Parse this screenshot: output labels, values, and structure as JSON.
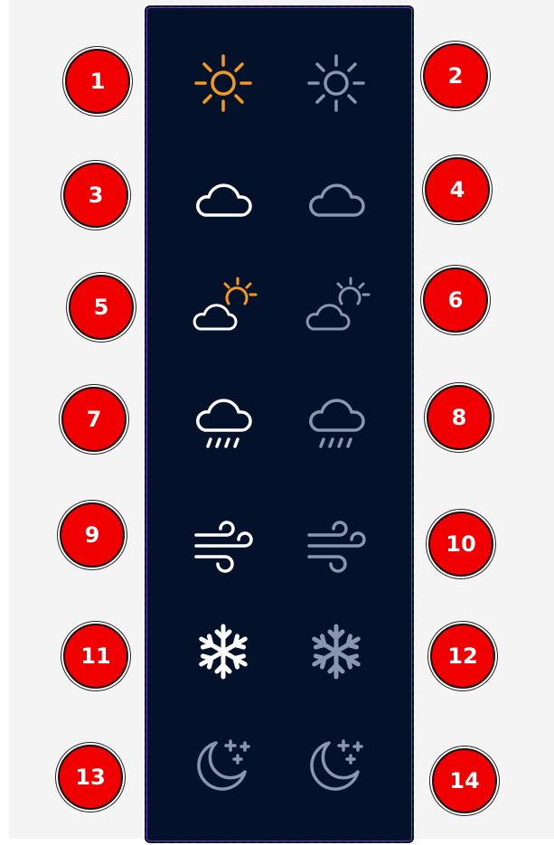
{
  "colors": {
    "panel_bg": "#04112a",
    "accent_orange": "#f39a1c",
    "white": "#ffffff",
    "gray": "#8a96ae",
    "badge_red": "#f00000"
  },
  "icons": [
    {
      "name": "sun-orange-icon",
      "color": "orange"
    },
    {
      "name": "sun-gray-icon",
      "color": "gray"
    },
    {
      "name": "cloud-white-icon",
      "color": "white"
    },
    {
      "name": "cloud-gray-icon",
      "color": "gray"
    },
    {
      "name": "partly-cloudy-white-icon",
      "color": "white"
    },
    {
      "name": "partly-cloudy-gray-icon",
      "color": "gray"
    },
    {
      "name": "rain-white-icon",
      "color": "white"
    },
    {
      "name": "rain-gray-icon",
      "color": "gray"
    },
    {
      "name": "wind-white-icon",
      "color": "white"
    },
    {
      "name": "wind-gray-icon",
      "color": "gray"
    },
    {
      "name": "snowflake-white-icon",
      "color": "white"
    },
    {
      "name": "snowflake-gray-icon",
      "color": "gray"
    },
    {
      "name": "moon-stars-gray-icon",
      "color": "gray"
    },
    {
      "name": "moon-stars-gray-icon",
      "color": "gray"
    }
  ],
  "badges": [
    "1",
    "2",
    "3",
    "4",
    "5",
    "6",
    "7",
    "8",
    "9",
    "10",
    "11",
    "12",
    "13",
    "14"
  ]
}
